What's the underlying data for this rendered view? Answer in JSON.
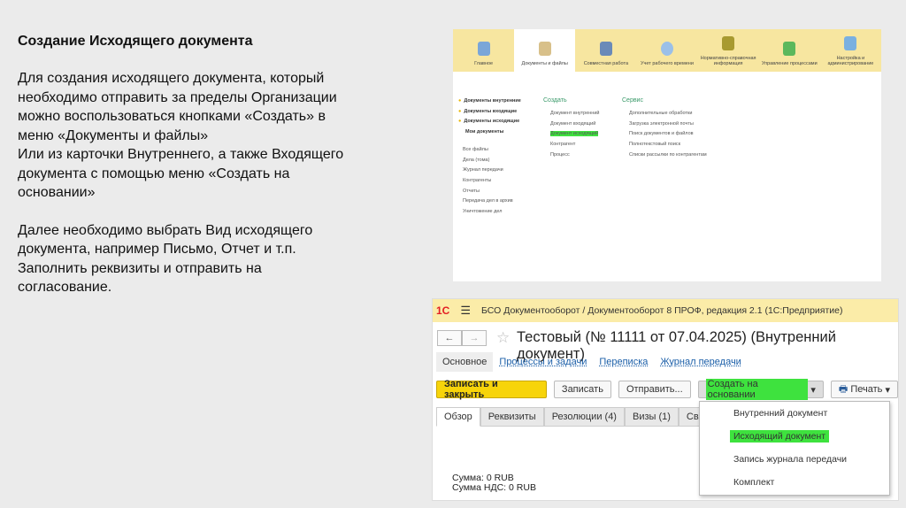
{
  "slide": {
    "title": "Создание Исходящего документа",
    "lines": [
      "Для создания исходящего документа, который",
      "необходимо отправить за пределы Организации",
      "можно воспользоваться кнопками «Создать» в",
      "меню «Документы и файлы»",
      "Или из карточки Внутреннего, а также Входящего",
      "документа с помощью меню «Создать на",
      "основании»",
      "",
      "Далее необходимо выбрать Вид исходящего",
      "документа, например Письмо, Отчет и т.п.",
      "Заполнить реквизиты и отправить на",
      "согласование."
    ]
  },
  "ss1": {
    "tabs": [
      "Главное",
      "Документы и файлы",
      "Совместная работа",
      "Учет рабочего времени",
      "Нормативно-справочная информация",
      "Управление процессами",
      "Настройка и администрирование"
    ],
    "left": [
      "Документы внутренние",
      "Документы входящие",
      "Документы исходящие",
      "Мои документы"
    ],
    "left2": [
      "Все файлы",
      "Дела (тома)",
      "Журнал передачи",
      "Контрагенты",
      "Отчеты",
      "Передача дел в архив",
      "Уничтожение дел"
    ],
    "create_title": "Создать",
    "create": [
      "Документ внутренний",
      "Документ входящий",
      "Документ исходящий",
      "Контрагент",
      "Процесс"
    ],
    "service_title": "Сервис",
    "service": [
      "Дополнительные обработки",
      "Загрузка электронной почты",
      "Поиск документов и файлов",
      "Полнотекстовый поиск",
      "Списки рассылки по контрагентам"
    ]
  },
  "ss2": {
    "app_title": "БСО Документооборот / Документооборот 8 ПРОФ, редакция 2.1  (1С:Предприятие)",
    "logo": "1С",
    "doc_title": "Тестовый (№ 11111 от 07.04.2025) (Внутренний документ)",
    "subtabs": [
      "Основное",
      "Процессы и задачи",
      "Переписка",
      "Журнал передачи"
    ],
    "buttons": {
      "save_close": "Записать и закрыть",
      "save": "Записать",
      "send": "Отправить...",
      "create_based": "Создать на основании",
      "print": "Печать"
    },
    "form_tabs": [
      "Обзор",
      "Реквизиты",
      "Резолюции (4)",
      "Визы (1)",
      "Свя"
    ],
    "sum": "Сумма: 0 RUB",
    "vat": "Сумма НДС: 0 RUB",
    "menu": [
      "Внутренний документ",
      "Исходящий документ",
      "Запись журнала передачи",
      "Комплект"
    ]
  }
}
